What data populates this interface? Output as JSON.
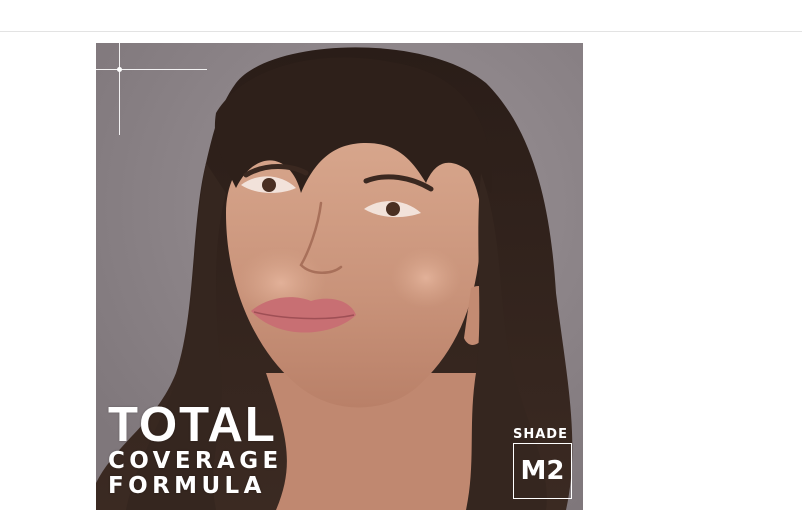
{
  "product_image": {
    "headline": {
      "line1": "TOTAL",
      "line2": "COVERAGE",
      "line3": "FORMULA"
    },
    "shade": {
      "label": "SHADE",
      "code": "M2"
    },
    "colors": {
      "background": "#8d8589",
      "text": "#ffffff"
    }
  }
}
